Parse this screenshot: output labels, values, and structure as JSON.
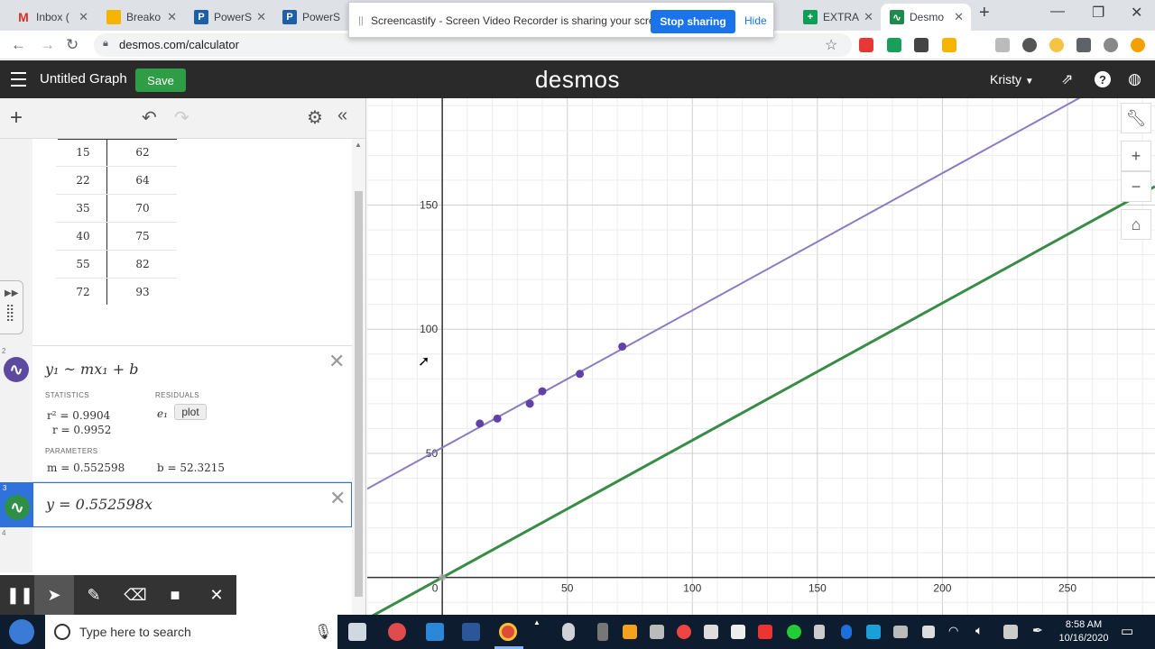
{
  "browser": {
    "tabs": [
      {
        "label": "Inbox (",
        "fav": "gmail-icon",
        "color": "#ffffff"
      },
      {
        "label": "Breako",
        "fav": "slides-icon",
        "color": "#f4b400"
      },
      {
        "label": "PowerS",
        "fav": "powerschool-icon",
        "color": "#1c5ea8"
      },
      {
        "label": "PowerS",
        "fav": "powerschool-icon",
        "color": "#1c5ea8"
      },
      {
        "label": "EXTRA",
        "fav": "sheets-icon",
        "color": "#0f9d58"
      },
      {
        "label": "Desmo",
        "fav": "desmos-icon",
        "color": "#1f8a4c"
      }
    ],
    "url": "desmos.com/calculator"
  },
  "screencastify": {
    "message": "Screencastify - Screen Video Recorder is sharing your screen.",
    "stop_label": "Stop sharing",
    "hide_label": "Hide"
  },
  "desmos": {
    "title": "Untitled Graph",
    "save_label": "Save",
    "logo": "desmos",
    "user": "Kristy"
  },
  "table": {
    "rows": [
      [
        "15",
        "62"
      ],
      [
        "22",
        "64"
      ],
      [
        "35",
        "70"
      ],
      [
        "40",
        "75"
      ],
      [
        "55",
        "82"
      ],
      [
        "72",
        "93"
      ]
    ]
  },
  "expressions": {
    "expr2": {
      "index": "2",
      "formula": "y₁ ~ mx₁ + b",
      "statistics_label": "STATISTICS",
      "r2": "r² = 0.9904",
      "r": "r = 0.9952",
      "residuals_label": "RESIDUALS",
      "residual_var": "e₁",
      "plot_label": "plot",
      "parameters_label": "PARAMETERS",
      "m": "m = 0.552598",
      "b": "b = 52.3215"
    },
    "expr3": {
      "index": "3",
      "formula": "y = 0.552598x"
    },
    "expr4": {
      "index": "4"
    }
  },
  "chart_data": {
    "type": "scatter",
    "x_ticks": [
      "0",
      "50",
      "100",
      "150",
      "200",
      "250"
    ],
    "y_ticks": [
      "50",
      "100",
      "150"
    ],
    "xlim": [
      -30,
      285
    ],
    "ylim": [
      -15,
      193
    ],
    "points": [
      {
        "x": 15,
        "y": 62
      },
      {
        "x": 22,
        "y": 64
      },
      {
        "x": 35,
        "y": 70
      },
      {
        "x": 40,
        "y": 75
      },
      {
        "x": 55,
        "y": 82
      },
      {
        "x": 72,
        "y": 93
      }
    ],
    "lines": [
      {
        "slope": 0.552598,
        "intercept": 52.3215,
        "color": "#8c7cc1"
      },
      {
        "slope": 0.552598,
        "intercept": 0,
        "color": "#388c46"
      }
    ],
    "point_color": "#6042a6",
    "grid": true
  },
  "taskbar": {
    "search_placeholder": "Type here to search",
    "time": "8:58 AM",
    "date": "10/16/2020"
  }
}
